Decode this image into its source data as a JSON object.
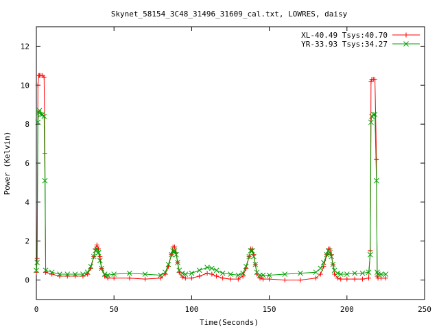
{
  "chart_data": {
    "type": "line",
    "title": "Skynet_58154_3C48_31496_31609_cal.txt, LOWRES, daisy",
    "xlabel": "Time(Seconds)",
    "ylabel": "Power (Kelvin)",
    "xlim": [
      0,
      250
    ],
    "ylim": [
      -1,
      13
    ],
    "xticks": [
      0,
      50,
      100,
      150,
      200,
      250
    ],
    "yticks": [
      0,
      2,
      4,
      6,
      8,
      10,
      12
    ],
    "grid": false,
    "legend_position": "top-right",
    "series": [
      {
        "name": "XL-40.49 Tsys:40.70",
        "color": "#ff0000",
        "marker": "plus",
        "x": [
          0,
          0.5,
          1,
          1.5,
          2,
          3,
          4,
          5,
          5.5,
          6,
          10,
          15,
          20,
          25,
          30,
          33,
          35,
          37,
          38,
          39,
          40,
          41,
          42,
          44,
          46,
          50,
          60,
          70,
          80,
          83,
          85,
          87,
          88,
          89,
          90,
          91,
          92,
          94,
          96,
          100,
          105,
          110,
          113,
          116,
          120,
          125,
          130,
          133,
          135,
          137,
          138,
          139,
          140,
          141,
          142,
          144,
          146,
          150,
          160,
          170,
          180,
          183,
          185,
          187,
          188,
          189,
          190,
          191,
          192,
          194,
          196,
          200,
          205,
          210,
          214,
          215,
          215.5,
          216,
          217,
          218,
          219,
          219.5,
          220,
          222,
          225
        ],
        "y": [
          0.4,
          1.1,
          10.0,
          10.5,
          10.5,
          10.5,
          10.5,
          10.4,
          6.5,
          0.4,
          0.3,
          0.2,
          0.2,
          0.2,
          0.2,
          0.3,
          0.6,
          1.2,
          1.6,
          1.8,
          1.6,
          1.2,
          0.6,
          0.2,
          0.1,
          0.1,
          0.1,
          0.05,
          0.1,
          0.3,
          0.7,
          1.3,
          1.7,
          1.7,
          1.4,
          0.9,
          0.4,
          0.15,
          0.1,
          0.1,
          0.2,
          0.35,
          0.3,
          0.2,
          0.1,
          0.05,
          0.05,
          0.2,
          0.6,
          1.2,
          1.6,
          1.6,
          1.3,
          0.8,
          0.3,
          0.1,
          0.05,
          0.05,
          0.0,
          0.0,
          0.1,
          0.3,
          0.7,
          1.3,
          1.6,
          1.6,
          1.3,
          0.8,
          0.3,
          0.1,
          0.05,
          0.05,
          0.05,
          0.05,
          0.1,
          1.5,
          10.2,
          10.3,
          10.3,
          10.3,
          6.2,
          0.2,
          0.1,
          0.1,
          0.1
        ]
      },
      {
        "name": "YR-33.93 Tsys:34.27",
        "color": "#00a000",
        "marker": "cross",
        "x": [
          0,
          0.5,
          1,
          1.5,
          2,
          3,
          4,
          5,
          5.5,
          6,
          10,
          15,
          20,
          25,
          30,
          33,
          35,
          37,
          38,
          39,
          40,
          41,
          42,
          44,
          46,
          50,
          60,
          70,
          80,
          83,
          85,
          87,
          88,
          89,
          90,
          91,
          92,
          94,
          96,
          100,
          105,
          110,
          113,
          116,
          120,
          125,
          130,
          133,
          135,
          137,
          138,
          139,
          140,
          141,
          142,
          144,
          146,
          150,
          160,
          170,
          180,
          183,
          185,
          187,
          188,
          189,
          190,
          191,
          192,
          194,
          196,
          200,
          205,
          210,
          214,
          215,
          215.5,
          216,
          217,
          218,
          219,
          219.5,
          220,
          222,
          225
        ],
        "y": [
          0.5,
          0.9,
          8.1,
          8.6,
          8.7,
          8.5,
          8.5,
          8.4,
          5.1,
          0.5,
          0.4,
          0.3,
          0.3,
          0.3,
          0.3,
          0.4,
          0.7,
          1.2,
          1.5,
          1.6,
          1.4,
          1.0,
          0.6,
          0.3,
          0.25,
          0.3,
          0.35,
          0.3,
          0.25,
          0.4,
          0.8,
          1.3,
          1.5,
          1.5,
          1.3,
          0.9,
          0.5,
          0.35,
          0.3,
          0.35,
          0.5,
          0.65,
          0.6,
          0.5,
          0.35,
          0.3,
          0.25,
          0.35,
          0.7,
          1.2,
          1.5,
          1.5,
          1.2,
          0.8,
          0.4,
          0.25,
          0.25,
          0.25,
          0.3,
          0.35,
          0.4,
          0.6,
          0.9,
          1.3,
          1.5,
          1.4,
          1.2,
          0.8,
          0.5,
          0.35,
          0.3,
          0.3,
          0.35,
          0.35,
          0.4,
          1.3,
          8.1,
          8.4,
          8.5,
          8.5,
          5.1,
          0.4,
          0.3,
          0.3,
          0.3
        ]
      }
    ]
  }
}
